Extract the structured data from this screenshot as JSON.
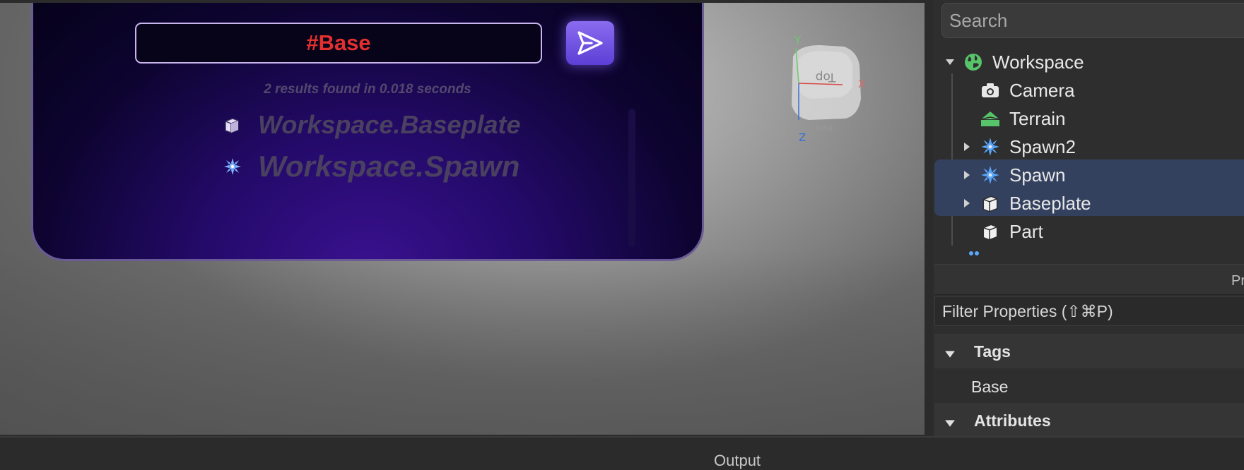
{
  "search_panel": {
    "query": "#Base",
    "results_summary": "2 results found in 0.018 seconds",
    "results": [
      {
        "label": "Workspace.Baseplate",
        "icon": "part-cube-icon"
      },
      {
        "label": "Workspace.Spawn",
        "icon": "spawn-icon"
      }
    ],
    "send_icon": "send-arrow-icon"
  },
  "gizmo": {
    "face_label": "Top",
    "back_label": "Back",
    "axis_x": "X",
    "axis_y": "Y",
    "axis_z": "Z"
  },
  "explorer": {
    "search_placeholder": "Search",
    "items": [
      {
        "name": "Workspace",
        "icon": "globe-icon",
        "expanded": true,
        "selected": false
      },
      {
        "name": "Camera",
        "icon": "camera-icon",
        "selected": false
      },
      {
        "name": "Terrain",
        "icon": "terrain-icon",
        "selected": false
      },
      {
        "name": "Spawn2",
        "icon": "spawn-icon",
        "collapsed_arrow": true,
        "selected": false
      },
      {
        "name": "Spawn",
        "icon": "spawn-icon",
        "collapsed_arrow": true,
        "selected": true
      },
      {
        "name": "Baseplate",
        "icon": "part-cube-icon",
        "collapsed_arrow": true,
        "selected": true
      },
      {
        "name": "Part",
        "icon": "part-cube-icon",
        "selected": false
      }
    ]
  },
  "properties": {
    "header_partial": "Pr",
    "filter_placeholder": "Filter Properties (⇧⌘P)",
    "sections": [
      {
        "label": "Tags",
        "expanded": true,
        "entries": [
          "Base"
        ]
      },
      {
        "label": "Attributes",
        "expanded": true
      }
    ]
  },
  "output": {
    "title": "Output"
  },
  "colors": {
    "query_text": "#e42f2f",
    "send_button": "#6f52e2",
    "selection": "#33415e"
  }
}
